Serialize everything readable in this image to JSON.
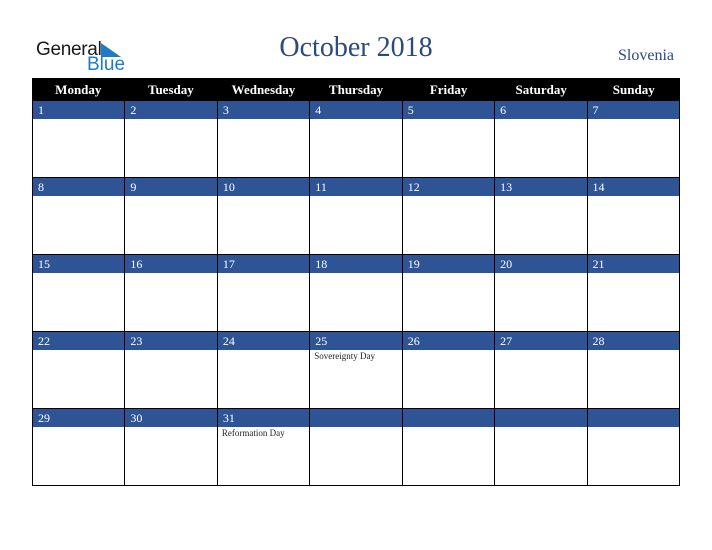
{
  "logo": {
    "line1": "General",
    "line2": "Blue"
  },
  "title": "October 2018",
  "country": "Slovenia",
  "weekdays": [
    "Monday",
    "Tuesday",
    "Wednesday",
    "Thursday",
    "Friday",
    "Saturday",
    "Sunday"
  ],
  "weeks": [
    {
      "days": [
        "1",
        "2",
        "3",
        "4",
        "5",
        "6",
        "7"
      ],
      "events": [
        "",
        "",
        "",
        "",
        "",
        "",
        ""
      ]
    },
    {
      "days": [
        "8",
        "9",
        "10",
        "11",
        "12",
        "13",
        "14"
      ],
      "events": [
        "",
        "",
        "",
        "",
        "",
        "",
        ""
      ]
    },
    {
      "days": [
        "15",
        "16",
        "17",
        "18",
        "19",
        "20",
        "21"
      ],
      "events": [
        "",
        "",
        "",
        "",
        "",
        "",
        ""
      ]
    },
    {
      "days": [
        "22",
        "23",
        "24",
        "25",
        "26",
        "27",
        "28"
      ],
      "events": [
        "",
        "",
        "",
        "Sovereignty Day",
        "",
        "",
        ""
      ]
    },
    {
      "days": [
        "29",
        "30",
        "31",
        "",
        "",
        "",
        ""
      ],
      "events": [
        "",
        "",
        "Reformation Day",
        "",
        "",
        "",
        ""
      ]
    }
  ],
  "colors": {
    "header_bg": "#000000",
    "day_bar": "#2e5496",
    "title": "#2b4a7e",
    "logo_blue": "#1e7bc4"
  }
}
